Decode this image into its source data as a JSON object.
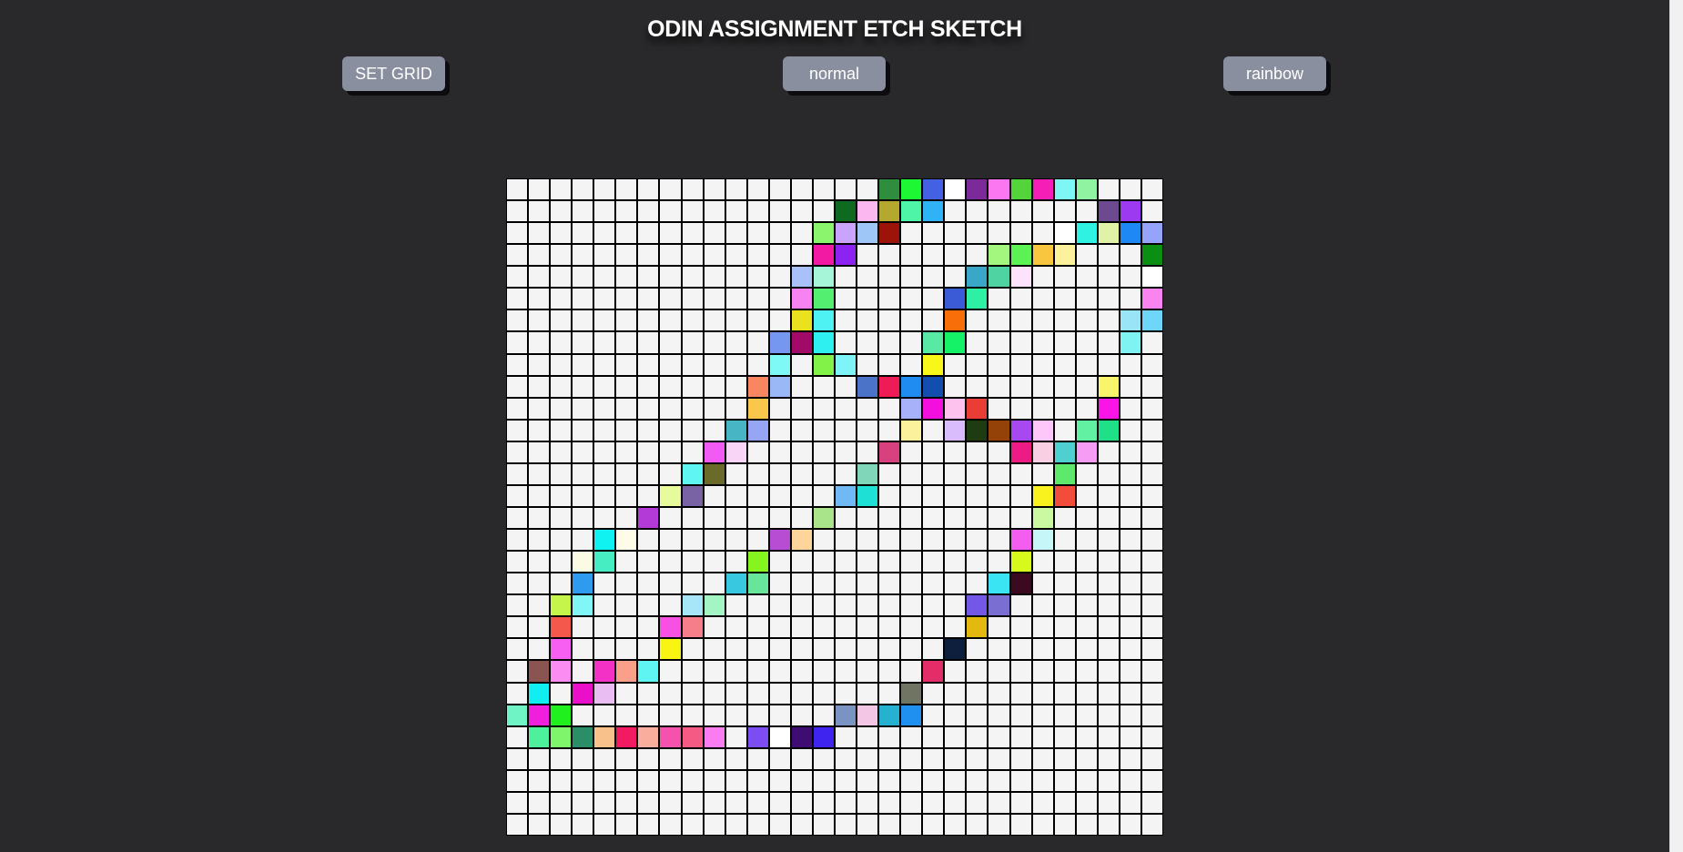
{
  "header": {
    "title": "ODIN ASSIGNMENT ETCH SKETCH"
  },
  "controls": {
    "set_grid_label": "SET GRID",
    "normal_label": "normal",
    "rainbow_label": "rainbow"
  },
  "grid": {
    "size": 30,
    "empty_color": "#f4f4f4",
    "line_color": "#000000",
    "painted": [
      {
        "r": 0,
        "c": 17,
        "color": "#2f8e3e"
      },
      {
        "r": 0,
        "c": 18,
        "color": "#1ef734"
      },
      {
        "r": 0,
        "c": 19,
        "color": "#4561e3"
      },
      {
        "r": 0,
        "c": 20,
        "color": "#ffffff"
      },
      {
        "r": 0,
        "c": 21,
        "color": "#7c2a9a"
      },
      {
        "r": 0,
        "c": 22,
        "color": "#fb76f1"
      },
      {
        "r": 0,
        "c": 23,
        "color": "#54d33a"
      },
      {
        "r": 0,
        "c": 24,
        "color": "#f51fb7"
      },
      {
        "r": 0,
        "c": 25,
        "color": "#7ef6f4"
      },
      {
        "r": 0,
        "c": 26,
        "color": "#8ff3a1"
      },
      {
        "r": 1,
        "c": 15,
        "color": "#0e6a20"
      },
      {
        "r": 1,
        "c": 16,
        "color": "#fbb7f0"
      },
      {
        "r": 1,
        "c": 17,
        "color": "#b4a82f"
      },
      {
        "r": 1,
        "c": 18,
        "color": "#4ff5a6"
      },
      {
        "r": 1,
        "c": 19,
        "color": "#2fb3f6"
      },
      {
        "r": 1,
        "c": 27,
        "color": "#6c4a8f"
      },
      {
        "r": 1,
        "c": 28,
        "color": "#9b3af1"
      },
      {
        "r": 2,
        "c": 14,
        "color": "#8bf56e"
      },
      {
        "r": 2,
        "c": 15,
        "color": "#c9a4fa"
      },
      {
        "r": 2,
        "c": 16,
        "color": "#9ec7f8"
      },
      {
        "r": 2,
        "c": 17,
        "color": "#9b1309"
      },
      {
        "r": 2,
        "c": 25,
        "color": "#ffffff"
      },
      {
        "r": 2,
        "c": 26,
        "color": "#2ff2e2"
      },
      {
        "r": 2,
        "c": 27,
        "color": "#e0f2a5"
      },
      {
        "r": 2,
        "c": 28,
        "color": "#1e88f5"
      },
      {
        "r": 2,
        "c": 29,
        "color": "#95a4fa"
      },
      {
        "r": 3,
        "c": 14,
        "color": "#f21aa2"
      },
      {
        "r": 3,
        "c": 15,
        "color": "#8d23f0"
      },
      {
        "r": 3,
        "c": 22,
        "color": "#a4f77e"
      },
      {
        "r": 3,
        "c": 23,
        "color": "#5df253"
      },
      {
        "r": 3,
        "c": 24,
        "color": "#f9c73f"
      },
      {
        "r": 3,
        "c": 25,
        "color": "#fbf29b"
      },
      {
        "r": 3,
        "c": 29,
        "color": "#0a8f12"
      },
      {
        "r": 4,
        "c": 13,
        "color": "#a9c1f8"
      },
      {
        "r": 4,
        "c": 14,
        "color": "#a6f5d8"
      },
      {
        "r": 4,
        "c": 21,
        "color": "#3aa7c9"
      },
      {
        "r": 4,
        "c": 22,
        "color": "#4fd3a2"
      },
      {
        "r": 4,
        "c": 23,
        "color": "#fde2fb"
      },
      {
        "r": 4,
        "c": 29,
        "color": "#ffffff"
      },
      {
        "r": 5,
        "c": 13,
        "color": "#f782f1"
      },
      {
        "r": 5,
        "c": 14,
        "color": "#53ef70"
      },
      {
        "r": 5,
        "c": 20,
        "color": "#3b5bd6"
      },
      {
        "r": 5,
        "c": 21,
        "color": "#2ef0a4"
      },
      {
        "r": 5,
        "c": 29,
        "color": "#f984ef"
      },
      {
        "r": 6,
        "c": 13,
        "color": "#ebe21f"
      },
      {
        "r": 6,
        "c": 14,
        "color": "#4ff2f2"
      },
      {
        "r": 6,
        "c": 20,
        "color": "#f86f0a"
      },
      {
        "r": 6,
        "c": 28,
        "color": "#99e4f6"
      },
      {
        "r": 6,
        "c": 29,
        "color": "#6ed6f8"
      },
      {
        "r": 7,
        "c": 12,
        "color": "#7597f0"
      },
      {
        "r": 7,
        "c": 13,
        "color": "#a10b67"
      },
      {
        "r": 7,
        "c": 14,
        "color": "#2ff0f0"
      },
      {
        "r": 7,
        "c": 19,
        "color": "#5ae8a5"
      },
      {
        "r": 7,
        "c": 20,
        "color": "#15f268"
      },
      {
        "r": 7,
        "c": 28,
        "color": "#7ff3f2"
      },
      {
        "r": 8,
        "c": 12,
        "color": "#7ff9f6"
      },
      {
        "r": 8,
        "c": 14,
        "color": "#82f148"
      },
      {
        "r": 8,
        "c": 15,
        "color": "#7ff4f6"
      },
      {
        "r": 8,
        "c": 19,
        "color": "#f9f61a"
      },
      {
        "r": 9,
        "c": 11,
        "color": "#f98661"
      },
      {
        "r": 9,
        "c": 12,
        "color": "#9ab8f5"
      },
      {
        "r": 9,
        "c": 16,
        "color": "#4b73c8"
      },
      {
        "r": 9,
        "c": 17,
        "color": "#ee1b57"
      },
      {
        "r": 9,
        "c": 18,
        "color": "#1f8cf1"
      },
      {
        "r": 9,
        "c": 19,
        "color": "#134eaf"
      },
      {
        "r": 9,
        "c": 27,
        "color": "#f8f56b"
      },
      {
        "r": 10,
        "c": 11,
        "color": "#fbc74a"
      },
      {
        "r": 10,
        "c": 18,
        "color": "#a7b1f9"
      },
      {
        "r": 10,
        "c": 19,
        "color": "#f30fde"
      },
      {
        "r": 10,
        "c": 20,
        "color": "#fdc3ee"
      },
      {
        "r": 10,
        "c": 21,
        "color": "#e93d35"
      },
      {
        "r": 10,
        "c": 27,
        "color": "#f915e6"
      },
      {
        "r": 11,
        "c": 10,
        "color": "#47b5c4"
      },
      {
        "r": 11,
        "c": 11,
        "color": "#96a6f4"
      },
      {
        "r": 11,
        "c": 18,
        "color": "#fbf09c"
      },
      {
        "r": 11,
        "c": 20,
        "color": "#d9bcfb"
      },
      {
        "r": 11,
        "c": 21,
        "color": "#1e3b11"
      },
      {
        "r": 11,
        "c": 22,
        "color": "#944208"
      },
      {
        "r": 11,
        "c": 23,
        "color": "#a848f0"
      },
      {
        "r": 11,
        "c": 24,
        "color": "#fdc7fa"
      },
      {
        "r": 11,
        "c": 26,
        "color": "#62f0a2"
      },
      {
        "r": 11,
        "c": 27,
        "color": "#1fe088"
      },
      {
        "r": 12,
        "c": 9,
        "color": "#f25af4"
      },
      {
        "r": 12,
        "c": 10,
        "color": "#f8d5f7"
      },
      {
        "r": 12,
        "c": 17,
        "color": "#d6417e"
      },
      {
        "r": 12,
        "c": 23,
        "color": "#ec1c84"
      },
      {
        "r": 12,
        "c": 24,
        "color": "#f9cfe3"
      },
      {
        "r": 12,
        "c": 25,
        "color": "#4fcfcf"
      },
      {
        "r": 12,
        "c": 26,
        "color": "#f79cf5"
      },
      {
        "r": 13,
        "c": 8,
        "color": "#5ff5f2"
      },
      {
        "r": 13,
        "c": 9,
        "color": "#6a6a2a"
      },
      {
        "r": 13,
        "c": 16,
        "color": "#7fd6b8"
      },
      {
        "r": 13,
        "c": 25,
        "color": "#5ee86c"
      },
      {
        "r": 14,
        "c": 7,
        "color": "#e8fb9c"
      },
      {
        "r": 14,
        "c": 8,
        "color": "#7a63a4"
      },
      {
        "r": 14,
        "c": 15,
        "color": "#70b9f5"
      },
      {
        "r": 14,
        "c": 16,
        "color": "#1ee0d5"
      },
      {
        "r": 14,
        "c": 24,
        "color": "#f9f21f"
      },
      {
        "r": 14,
        "c": 25,
        "color": "#f24c3d"
      },
      {
        "r": 15,
        "c": 6,
        "color": "#b33ad6"
      },
      {
        "r": 15,
        "c": 14,
        "color": "#a9e48b"
      },
      {
        "r": 15,
        "c": 24,
        "color": "#cbf9a2"
      },
      {
        "r": 16,
        "c": 4,
        "color": "#10f2f2"
      },
      {
        "r": 16,
        "c": 5,
        "color": "#fefbe8"
      },
      {
        "r": 16,
        "c": 12,
        "color": "#b64dd3"
      },
      {
        "r": 16,
        "c": 13,
        "color": "#fdd59a"
      },
      {
        "r": 16,
        "c": 23,
        "color": "#f45ef0"
      },
      {
        "r": 16,
        "c": 24,
        "color": "#c6f6f7"
      },
      {
        "r": 17,
        "c": 3,
        "color": "#fbfbe3"
      },
      {
        "r": 17,
        "c": 4,
        "color": "#46ecc2"
      },
      {
        "r": 17,
        "c": 11,
        "color": "#86f51f"
      },
      {
        "r": 17,
        "c": 23,
        "color": "#d8f91c"
      },
      {
        "r": 18,
        "c": 3,
        "color": "#2f9bef"
      },
      {
        "r": 18,
        "c": 10,
        "color": "#38c9e0"
      },
      {
        "r": 18,
        "c": 11,
        "color": "#68e59b"
      },
      {
        "r": 18,
        "c": 22,
        "color": "#3be4f2"
      },
      {
        "r": 18,
        "c": 23,
        "color": "#3b0a20"
      },
      {
        "r": 19,
        "c": 2,
        "color": "#c5f54a"
      },
      {
        "r": 19,
        "c": 3,
        "color": "#82f5f7"
      },
      {
        "r": 19,
        "c": 8,
        "color": "#a7e6f9"
      },
      {
        "r": 19,
        "c": 9,
        "color": "#a4f5c4"
      },
      {
        "r": 19,
        "c": 21,
        "color": "#7358e8"
      },
      {
        "r": 19,
        "c": 22,
        "color": "#7a6ed3"
      },
      {
        "r": 20,
        "c": 2,
        "color": "#f4584d"
      },
      {
        "r": 20,
        "c": 7,
        "color": "#f850e2"
      },
      {
        "r": 20,
        "c": 8,
        "color": "#f57e8a"
      },
      {
        "r": 20,
        "c": 21,
        "color": "#e4b90f"
      },
      {
        "r": 21,
        "c": 2,
        "color": "#f65ff2"
      },
      {
        "r": 21,
        "c": 7,
        "color": "#f9f513"
      },
      {
        "r": 21,
        "c": 20,
        "color": "#0d1f3c"
      },
      {
        "r": 22,
        "c": 1,
        "color": "#8a5450"
      },
      {
        "r": 22,
        "c": 2,
        "color": "#fb8cf2"
      },
      {
        "r": 22,
        "c": 4,
        "color": "#f331c6"
      },
      {
        "r": 22,
        "c": 5,
        "color": "#f99f8a"
      },
      {
        "r": 22,
        "c": 6,
        "color": "#5ff4f2"
      },
      {
        "r": 22,
        "c": 19,
        "color": "#e22d68"
      },
      {
        "r": 23,
        "c": 1,
        "color": "#10eef2"
      },
      {
        "r": 23,
        "c": 3,
        "color": "#ea10c9"
      },
      {
        "r": 23,
        "c": 4,
        "color": "#e9bcf2"
      },
      {
        "r": 23,
        "c": 18,
        "color": "#6f7562"
      },
      {
        "r": 24,
        "c": 0,
        "color": "#6ff5c5"
      },
      {
        "r": 24,
        "c": 1,
        "color": "#ef1fdb"
      },
      {
        "r": 24,
        "c": 2,
        "color": "#1ff01e"
      },
      {
        "r": 24,
        "c": 15,
        "color": "#7a93c3"
      },
      {
        "r": 24,
        "c": 16,
        "color": "#f2c6e4"
      },
      {
        "r": 24,
        "c": 17,
        "color": "#27b1d1"
      },
      {
        "r": 24,
        "c": 18,
        "color": "#1f8ff0"
      },
      {
        "r": 25,
        "c": 1,
        "color": "#4ef09c"
      },
      {
        "r": 25,
        "c": 2,
        "color": "#7ef56a"
      },
      {
        "r": 25,
        "c": 3,
        "color": "#2a8f69"
      },
      {
        "r": 25,
        "c": 4,
        "color": "#f8c08a"
      },
      {
        "r": 25,
        "c": 5,
        "color": "#f21a60"
      },
      {
        "r": 25,
        "c": 6,
        "color": "#f9ad9c"
      },
      {
        "r": 25,
        "c": 7,
        "color": "#f552ad"
      },
      {
        "r": 25,
        "c": 8,
        "color": "#f45a83"
      },
      {
        "r": 25,
        "c": 9,
        "color": "#f97cf1"
      },
      {
        "r": 25,
        "c": 11,
        "color": "#7c4df0"
      },
      {
        "r": 25,
        "c": 12,
        "color": "#ffffff"
      },
      {
        "r": 25,
        "c": 13,
        "color": "#3e0c73"
      },
      {
        "r": 25,
        "c": 14,
        "color": "#3f24ef"
      }
    ]
  }
}
